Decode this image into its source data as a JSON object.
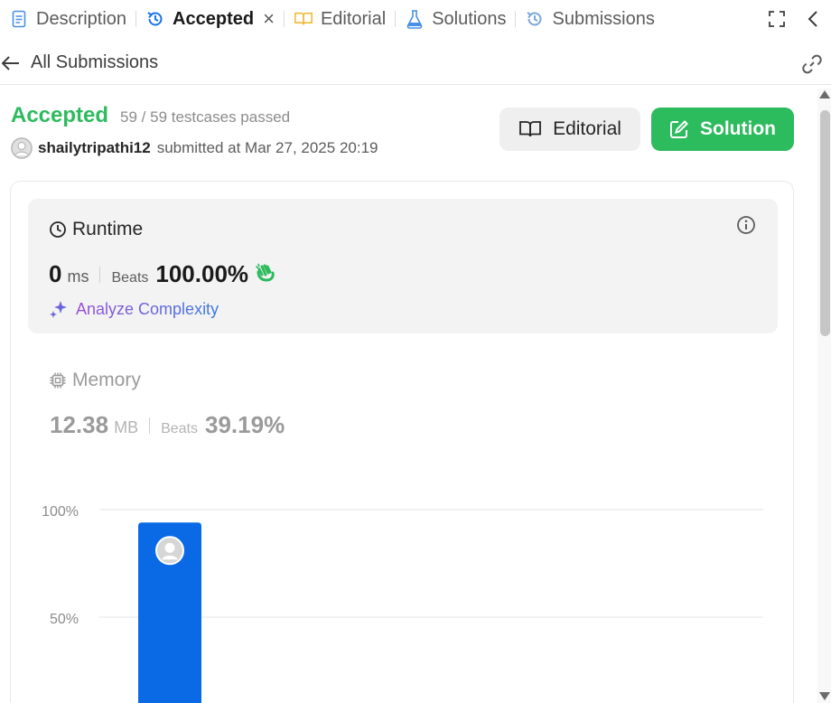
{
  "tabs": [
    {
      "label": "Description",
      "icon": "document-icon",
      "active": false
    },
    {
      "label": "Accepted",
      "icon": "history-icon",
      "active": true
    },
    {
      "label": "Editorial",
      "icon": "book-icon",
      "active": false
    },
    {
      "label": "Solutions",
      "icon": "flask-icon",
      "active": false
    },
    {
      "label": "Submissions",
      "icon": "history-icon",
      "active": false
    }
  ],
  "subheader": {
    "title": "All Submissions"
  },
  "result": {
    "status": "Accepted",
    "testcases": "59 / 59 testcases passed",
    "username": "shailytripathi12",
    "submitted": "submitted at Mar 27, 2025 20:19"
  },
  "buttons": {
    "editorial": "Editorial",
    "solution": "Solution"
  },
  "runtime": {
    "title": "Runtime",
    "value": "0",
    "unit": "ms",
    "beats_label": "Beats",
    "beats_value": "100.00%",
    "analyze": "Analyze Complexity"
  },
  "memory": {
    "title": "Memory",
    "value": "12.38",
    "unit": "MB",
    "beats_label": "Beats",
    "beats_value": "39.19%"
  },
  "chart_data": {
    "type": "bar",
    "tick_labels": [
      "100%",
      "50%"
    ],
    "ticks": [
      100,
      50
    ],
    "ylim": [
      0,
      100
    ],
    "values": [
      94
    ],
    "bar_color": "#0a6ae6"
  },
  "colors": {
    "accent_green": "#2cbb5d",
    "tab_blue": "#1a73e8",
    "bar_blue": "#0a6ae6"
  }
}
